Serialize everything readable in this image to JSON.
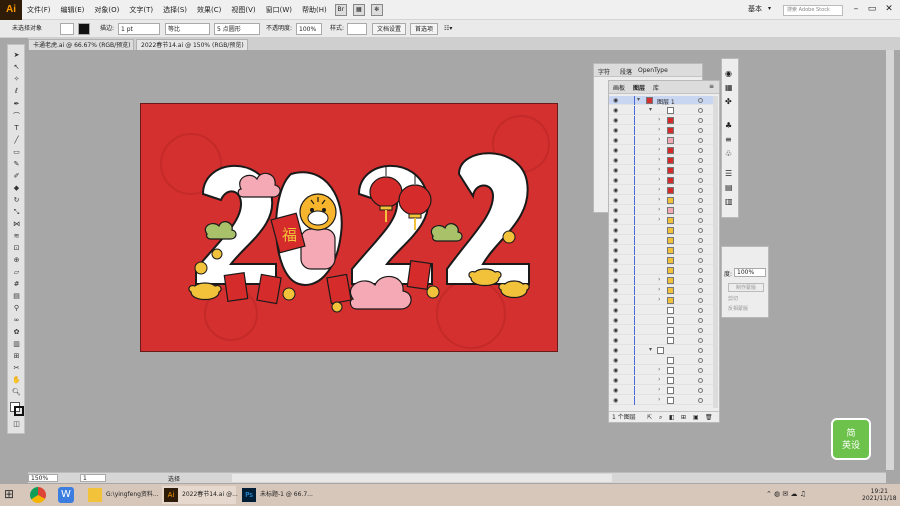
{
  "app": {
    "logo": "Ai"
  },
  "menu": {
    "items": [
      "文件(F)",
      "编辑(E)",
      "对象(O)",
      "文字(T)",
      "选择(S)",
      "效果(C)",
      "视图(V)",
      "窗口(W)",
      "帮助(H)"
    ],
    "workspace": "基本",
    "stock_search": "搜索 Adobe Stock"
  },
  "control": {
    "selection": "未选择对象",
    "stroke_label": "描边:",
    "stroke_value": "1 pt",
    "line_style": "等比",
    "brush": "5 点圆形",
    "opacity_label": "不透明度:",
    "opacity_value": "100%",
    "style_label": "样式:",
    "doc_setup": "文档设置",
    "prefs": "首选项"
  },
  "tabs": [
    {
      "label": "卡通老虎.ai @ 66.67% (RGB/预览)"
    },
    {
      "label": "2022春节14.ai @ 150% (RGB/预览)"
    }
  ],
  "panels": {
    "char": {
      "tabs": [
        "字符",
        "段落",
        "OpenType"
      ]
    },
    "layers": {
      "tabs": [
        "画板",
        "图层",
        "库"
      ],
      "top_layer": "图层 1",
      "count": "1 个图层"
    },
    "transparency": {
      "opacity_label": "度:",
      "opacity_value": "100%",
      "btn": "制作蒙版",
      "clip": "剪切",
      "invert": "反相蒙版"
    }
  },
  "status": {
    "zoom": "150%",
    "page": "1",
    "tool": "选择"
  },
  "taskbar": {
    "apps": [
      {
        "label": "G:\\yingfeng资料..."
      },
      {
        "label": "2022春节14.ai @..."
      },
      {
        "label": "未标题-1 @ 66.7..."
      }
    ],
    "time": "19:21",
    "date": "2021/11/18"
  },
  "watermark": {
    "text": "简\n英设"
  },
  "artwork": {
    "title_digits": "2022",
    "fu": "福"
  },
  "colors": {
    "artboard": "#d3302f",
    "accent": "#2f1c08",
    "selection_blue": "#4a6ad8"
  }
}
